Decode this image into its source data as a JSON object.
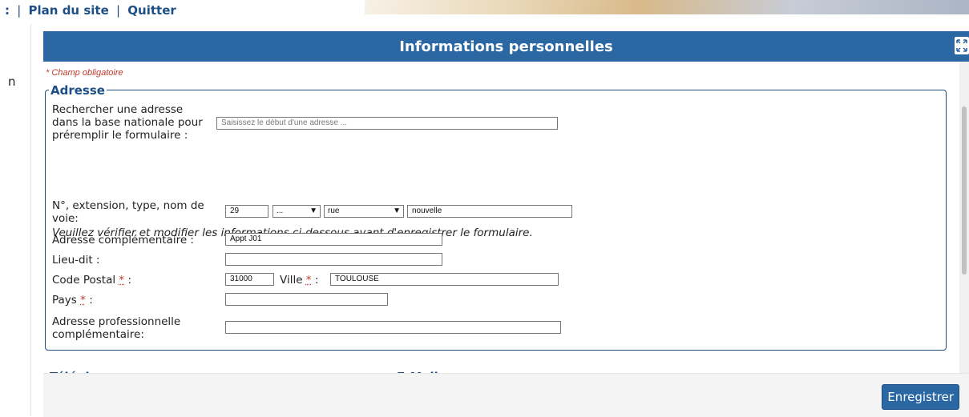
{
  "top": {
    "links_prefix": ":",
    "separator": "|",
    "link_plan": "Plan du site",
    "link_quit": "Quitter"
  },
  "rail": {
    "letter": "n"
  },
  "modal": {
    "title": "Informations personnelles",
    "expand_icon": "expand-icon",
    "required_note": "* Champ obligatoire",
    "save_label": "Enregistrer"
  },
  "address": {
    "legend": "Adresse",
    "search": {
      "label_line1": "Rechercher une adresse",
      "label_line2": "dans la base nationale pour",
      "label_line3": "préremplir le formulaire :",
      "placeholder": "Saisissez le début d'une adresse ..."
    },
    "notice": "Veuillez vérifier et modifier les informations ci-dessous avant d'enregistrer le formulaire.",
    "street": {
      "label_line1": "N°, extension, type, nom de",
      "label_line2": "voie:",
      "number": "29",
      "extension": "...",
      "type": "rue",
      "name": "nouvelle"
    },
    "complement": {
      "label": "Adresse complémentaire :",
      "value": "Appt J01"
    },
    "lieu_dit": {
      "label": "Lieu-dit :",
      "value": ""
    },
    "postal": {
      "label": "Code Postal",
      "star": "*",
      "colon": ":",
      "value": "31000"
    },
    "ville": {
      "label": "Ville",
      "star": "*",
      "colon": ":",
      "value": "TOULOUSE"
    },
    "pays": {
      "label": "Pays",
      "star": "*",
      "colon": ":",
      "value": ""
    },
    "pro": {
      "label_line1": "Adresse professionnelle",
      "label_line2": "complémentaire:",
      "value": ""
    }
  },
  "peek": {
    "left": "Téléphone",
    "right": "E-Mail"
  },
  "colors": {
    "header_bg": "#2a67a3",
    "accent": "#1d4f86",
    "required": "#c0392b"
  }
}
